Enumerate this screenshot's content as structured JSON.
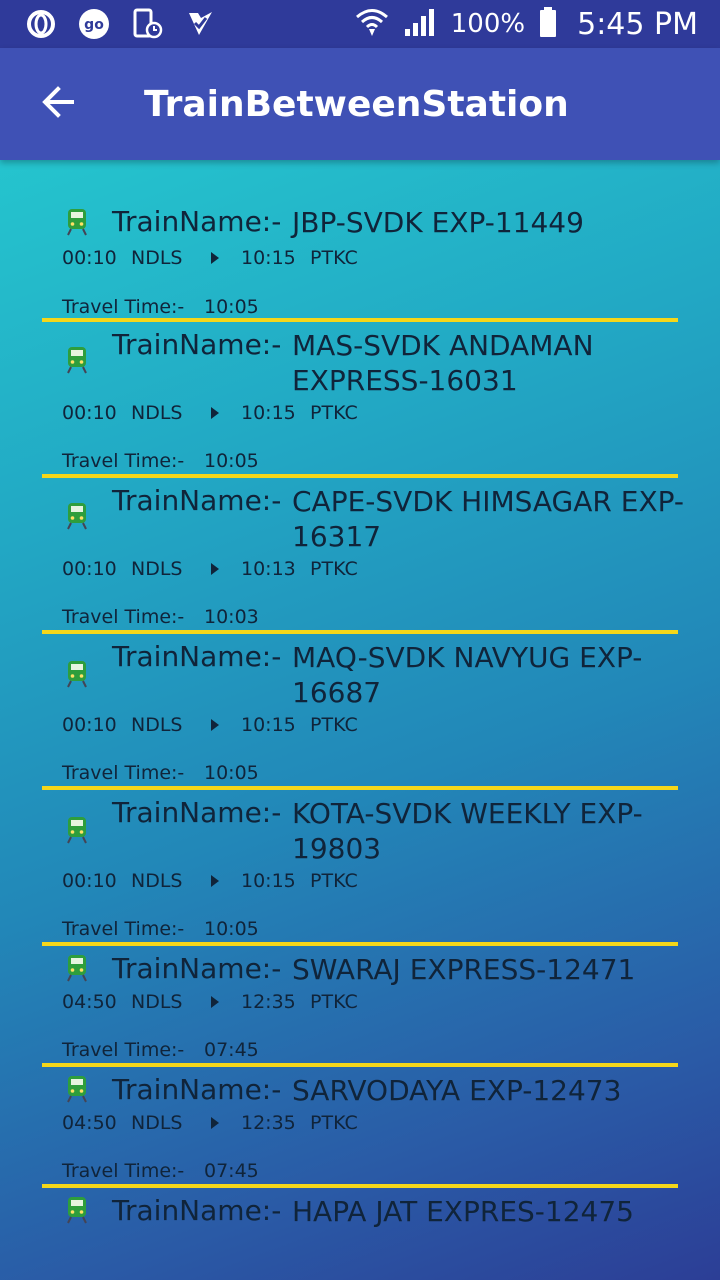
{
  "status_bar": {
    "battery": "100%",
    "time": "5:45 PM",
    "left_icons": [
      "opera-icon",
      "go-icon",
      "phone-clock-icon",
      "check-icon"
    ],
    "right_icons": [
      "wifi-icon",
      "signal-icon",
      "battery-icon"
    ]
  },
  "app_bar": {
    "title": "TrainBetweenStation",
    "back_icon": "arrow-back-icon"
  },
  "labels": {
    "train_name": "TrainName:-",
    "travel_time": "Travel Time:-"
  },
  "colors": {
    "app_bar": "#3f51b5",
    "status_bar": "#2f3a9a",
    "divider": "#f5d71a",
    "train_icon": "#2e9e3c"
  },
  "trains": [
    {
      "name": "JBP-SVDK EXP-11449",
      "departure": "00:10",
      "from": "NDLS",
      "arrival": "10:15",
      "to": "PTKC",
      "travel_time": "10:05"
    },
    {
      "name": "MAS-SVDK ANDAMAN EXPRESS-16031",
      "departure": "00:10",
      "from": "NDLS",
      "arrival": "10:15",
      "to": "PTKC",
      "travel_time": "10:05"
    },
    {
      "name": "CAPE-SVDK HIMSAGAR EXP-16317",
      "departure": "00:10",
      "from": "NDLS",
      "arrival": "10:13",
      "to": "PTKC",
      "travel_time": "10:03"
    },
    {
      "name": "MAQ-SVDK NAVYUG EXP-16687",
      "departure": "00:10",
      "from": "NDLS",
      "arrival": "10:15",
      "to": "PTKC",
      "travel_time": "10:05"
    },
    {
      "name": "KOTA-SVDK WEEKLY EXP-19803",
      "departure": "00:10",
      "from": "NDLS",
      "arrival": "10:15",
      "to": "PTKC",
      "travel_time": "10:05"
    },
    {
      "name": "SWARAJ EXPRESS-12471",
      "departure": "04:50",
      "from": "NDLS",
      "arrival": "12:35",
      "to": "PTKC",
      "travel_time": "07:45"
    },
    {
      "name": "SARVODAYA EXP-12473",
      "departure": "04:50",
      "from": "NDLS",
      "arrival": "12:35",
      "to": "PTKC",
      "travel_time": "07:45"
    },
    {
      "name": "HAPA JAT EXPRES-12475",
      "departure": "",
      "from": "",
      "arrival": "",
      "to": "",
      "travel_time": ""
    }
  ]
}
